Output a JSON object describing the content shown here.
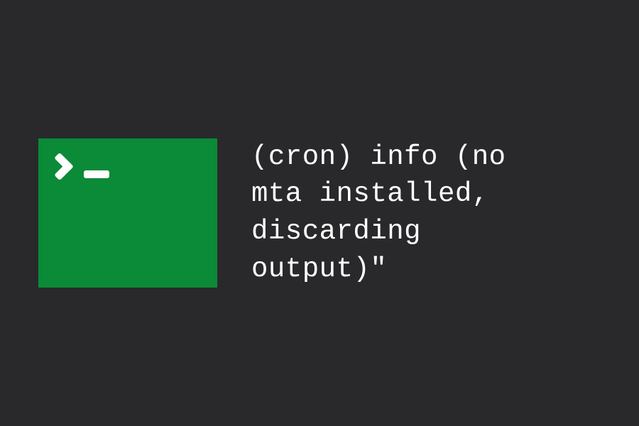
{
  "terminal": {
    "icon_name": "terminal-icon",
    "background_color": "#0b8a37"
  },
  "message": {
    "text": "(cron) info (no\nmta installed,\ndiscarding\noutput)\""
  },
  "colors": {
    "background": "#29292b",
    "terminal_bg": "#0b8a37",
    "text": "#ffffff"
  }
}
